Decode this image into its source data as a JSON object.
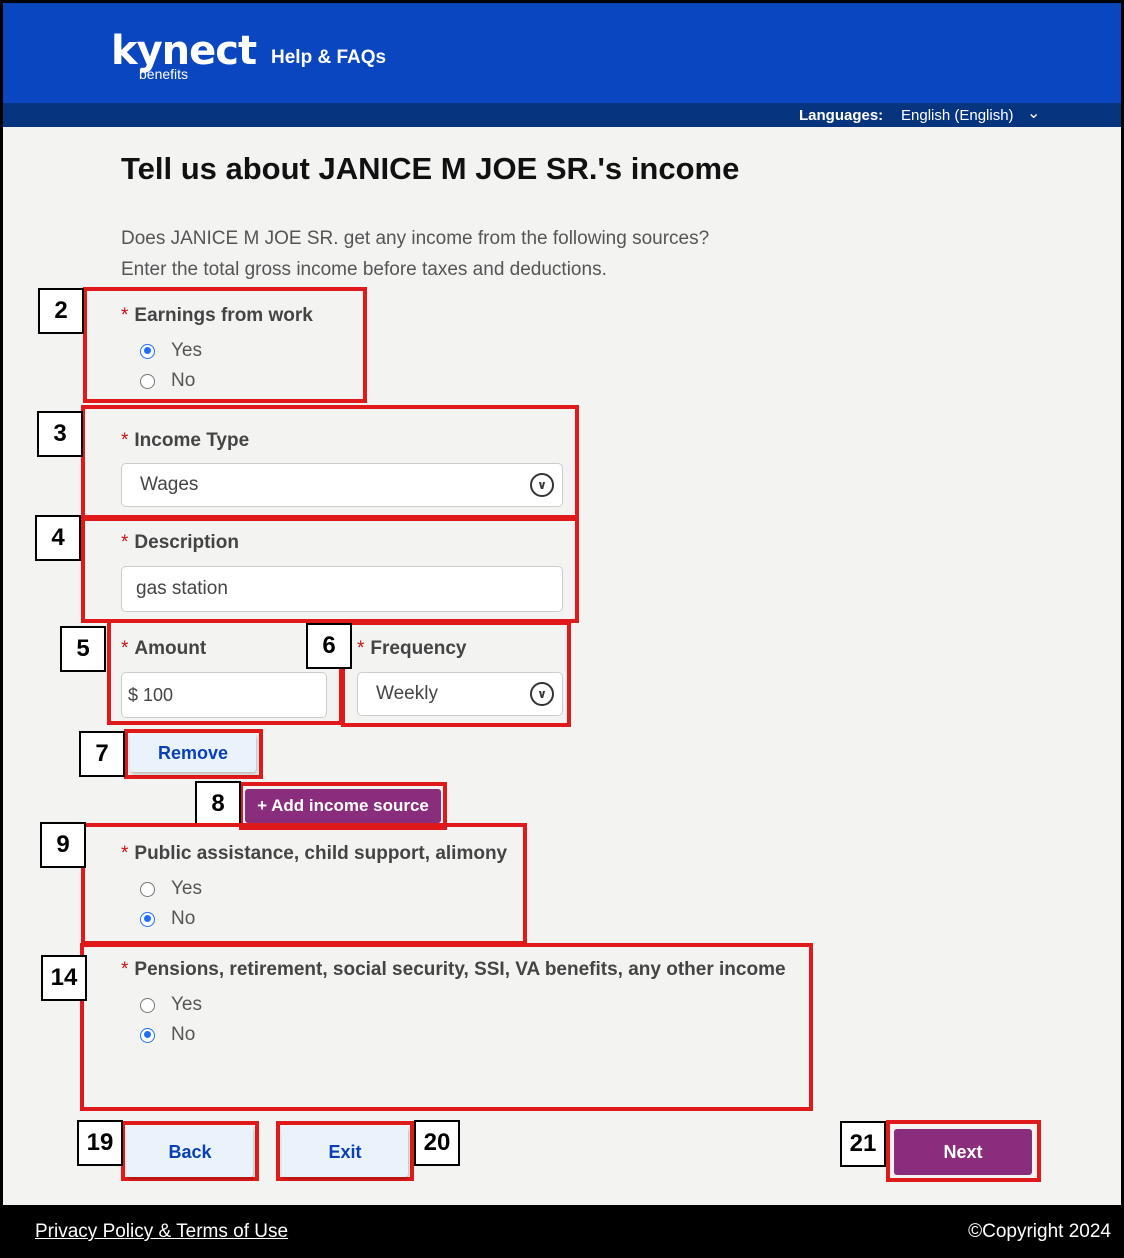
{
  "header": {
    "logo_main": "kynect",
    "logo_sub": "benefits",
    "help": "Help & FAQs",
    "languages_label": "Languages:",
    "language_value": "English (English)"
  },
  "page": {
    "title": "Tell us about JANICE M JOE SR.'s income",
    "intro_line1": "Does JANICE M JOE SR. get any income from the following sources?",
    "intro_line2": "Enter the total gross income before taxes and deductions."
  },
  "earnings": {
    "label": "Earnings from work",
    "yes": "Yes",
    "no": "No",
    "selected": "Yes"
  },
  "income_type": {
    "label": "Income Type",
    "value": "Wages"
  },
  "description": {
    "label": "Description",
    "value": "gas station"
  },
  "amount": {
    "label": "Amount",
    "value": "$ 100"
  },
  "frequency": {
    "label": "Frequency",
    "value": "Weekly"
  },
  "buttons": {
    "remove": "Remove",
    "add_income": "+ Add income source",
    "back": "Back",
    "exit": "Exit",
    "next": "Next"
  },
  "public_assistance": {
    "label": "Public assistance, child support, alimony",
    "yes": "Yes",
    "no": "No",
    "selected": "No"
  },
  "pensions": {
    "label": "Pensions, retirement, social security, SSI, VA benefits, any other income",
    "yes": "Yes",
    "no": "No",
    "selected": "No"
  },
  "callouts": [
    "2",
    "3",
    "4",
    "5",
    "6",
    "7",
    "8",
    "9",
    "14",
    "19",
    "20",
    "21"
  ],
  "required_mark": "*",
  "footer": {
    "privacy": "Privacy Policy & Terms of Use",
    "copyright": "©Copyright 2024"
  },
  "colors": {
    "header_blue": "#0a46bf",
    "lang_bar": "#06347f",
    "highlight_red": "#e01a1a",
    "next_purple": "#8a2d7c"
  }
}
